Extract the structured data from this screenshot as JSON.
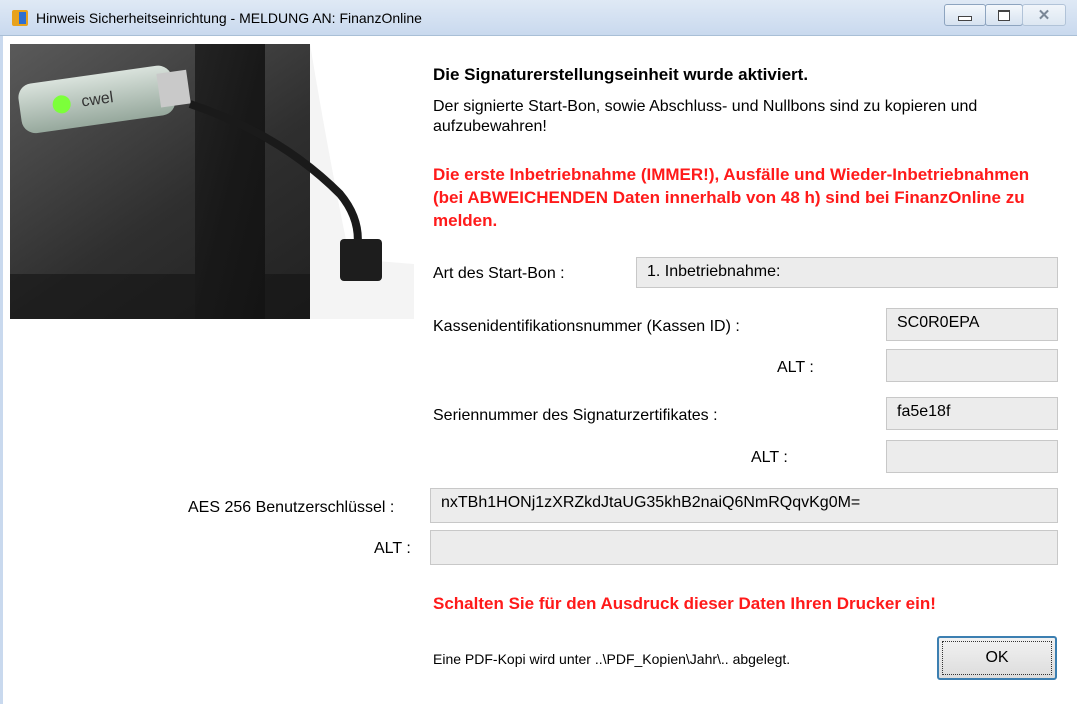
{
  "window": {
    "title": "Hinweis Sicherheitseinrichtung - MELDUNG AN: FinanzOnline"
  },
  "photo": {
    "alt": "USB-Sicherheitseinrichtung an Gehäuse"
  },
  "heading": "Die Signaturerstellungseinheit wurde aktiviert.",
  "info": "Der signierte Start-Bon, sowie Abschluss- und Nullbons sind zu kopieren und aufzubewahren!",
  "warning": "Die erste Inbetriebnahme (IMMER!), Ausfälle und Wieder-Inbetriebnahmen (bei ABWEICHENDEN Daten innerhalb von 48 h) sind bei FinanzOnline zu melden.",
  "start_bon": {
    "label": "Art des Start-Bon :",
    "value": "1. Inbetriebnahme:"
  },
  "kassen_id": {
    "label": "Kassenidentifikationsnummer (Kassen ID) :",
    "value": "SC0R0EPA",
    "alt_label": "ALT :",
    "alt_value": ""
  },
  "serial": {
    "label": "Seriennummer des Signaturzertifikates :",
    "value": "fa5e18f",
    "alt_label": "ALT :",
    "alt_value": ""
  },
  "aes": {
    "label": "AES 256 Benutzerschlüssel :",
    "value": "nxTBh1HONj1zXRZkdJtaUG35khB2naiQ6NmRQqvKg0M=",
    "alt_label": "ALT :",
    "alt_value": ""
  },
  "footer": {
    "printer_notice": "Schalten Sie für den Ausdruck dieser Daten Ihren Drucker ein!",
    "pdf_note": "Eine PDF-Kopi wird unter ..\\PDF_Kopien\\Jahr\\.. abgelegt.",
    "ok_label": "OK"
  }
}
